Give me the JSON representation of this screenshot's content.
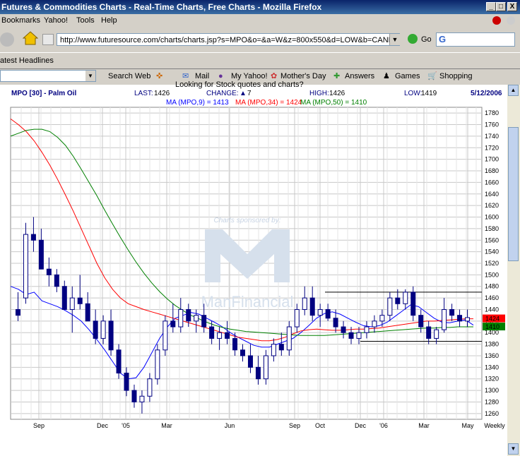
{
  "window": {
    "title": "Futures & Commodities Charts - Real-Time Charts, Free Charts - Mozilla Firefox",
    "min_label": "_",
    "max_label": "□",
    "close_label": "X"
  },
  "menu": {
    "items": [
      "Bookmarks",
      "Yahoo!",
      "Tools",
      "Help"
    ]
  },
  "nav": {
    "url": "http://www.futuresource.com/charts/charts.jsp?s=MPO&o=&a=W&z=800x550&d=LOW&b=CANDLE&st=MA",
    "go_label": "Go"
  },
  "bookmarks": {
    "headlines": "atest Headlines"
  },
  "toolbar": {
    "search_web": "Search Web",
    "mail": "Mail",
    "my_yahoo": "My Yahoo!",
    "mothers_day": "Mother's Day",
    "answers": "Answers",
    "games": "Games",
    "shopping": "Shopping"
  },
  "page": {
    "banner_text": "Looking for Stock quotes and charts?"
  },
  "chart_header": {
    "symbol": "MPO [30] - Palm Oil",
    "last_label": "LAST:",
    "last_value": "1426",
    "change_label": "CHANGE:",
    "change_arrow": "▲",
    "change_value": "7",
    "high_label": "HIGH:",
    "high_value": "1426",
    "low_label": "LOW:",
    "low_value": "1419",
    "date": "5/12/2006"
  },
  "ma_legend": {
    "ma9": "MA (MPO,9) = 1413",
    "ma34": "MA (MPO,34) = 1424",
    "ma50": "MA (MPO,50) = 1410"
  },
  "watermark": {
    "sponsor": "Charts sponsored by:",
    "brand": "ManFinancial"
  },
  "colors": {
    "ma9": "#0000ff",
    "ma34": "#ff0000",
    "ma50": "#008000",
    "candle": "#000080",
    "grid": "#c8c8c8"
  },
  "chart_data": {
    "type": "candlestick",
    "ylim": [
      1250,
      1790
    ],
    "y_ticks": [
      1260,
      1280,
      1300,
      1320,
      1340,
      1360,
      1380,
      1400,
      1420,
      1440,
      1460,
      1480,
      1500,
      1520,
      1540,
      1560,
      1580,
      1600,
      1620,
      1640,
      1660,
      1680,
      1700,
      1720,
      1740,
      1760,
      1780
    ],
    "x_labels": [
      "Sep",
      "Dec",
      "'05",
      "Mar",
      "Jun",
      "Sep",
      "Oct",
      "Dec",
      "'06",
      "Mar",
      "May",
      "Weekly"
    ],
    "price_tags": [
      {
        "value": 1424,
        "label": "1424",
        "color": "#ff0000"
      },
      {
        "value": 1410,
        "label": "1410",
        "color": "#008000"
      }
    ],
    "series": [
      {
        "name": "MA (MPO,9)",
        "values": [
          1480,
          1475,
          1466,
          1470,
          1455,
          1450,
          1445,
          1438,
          1430,
          1420,
          1405,
          1388,
          1370,
          1350,
          1330,
          1320,
          1322,
          1340,
          1365,
          1390,
          1410,
          1425,
          1430,
          1435,
          1432,
          1425,
          1418,
          1410,
          1400,
          1392,
          1385,
          1378,
          1375,
          1375,
          1380,
          1385,
          1390,
          1400,
          1412,
          1425,
          1433,
          1436,
          1432,
          1425,
          1418,
          1412,
          1410,
          1412,
          1418,
          1428,
          1438,
          1448,
          1445,
          1435,
          1425,
          1418,
          1417,
          1420,
          1422,
          1413
        ]
      },
      {
        "name": "MA (MPO,34)",
        "values": [
          1770,
          1760,
          1748,
          1732,
          1712,
          1690,
          1665,
          1638,
          1610,
          1580,
          1550,
          1520,
          1495,
          1475,
          1460,
          1450,
          1445,
          1440,
          1436,
          1432,
          1428,
          1424,
          1420,
          1416,
          1412,
          1408,
          1404,
          1400,
          1396,
          1392,
          1390,
          1388,
          1386,
          1386,
          1388,
          1392,
          1398,
          1403,
          1405,
          1406,
          1405,
          1404,
          1404,
          1405,
          1406,
          1406,
          1407,
          1408,
          1410,
          1412,
          1414,
          1416,
          1418,
          1420,
          1420,
          1421,
          1422,
          1423,
          1424,
          1424
        ]
      },
      {
        "name": "MA (MPO,50)",
        "values": [
          1740,
          1745,
          1750,
          1752,
          1752,
          1748,
          1738,
          1724,
          1705,
          1683,
          1660,
          1637,
          1612,
          1588,
          1565,
          1543,
          1522,
          1503,
          1486,
          1471,
          1458,
          1447,
          1438,
          1430,
          1424,
          1418,
          1413,
          1409,
          1406,
          1404,
          1402,
          1401,
          1400,
          1399,
          1398,
          1397,
          1396,
          1395,
          1395,
          1395,
          1395,
          1396,
          1397,
          1398,
          1399,
          1400,
          1401,
          1402,
          1403,
          1404,
          1405,
          1406,
          1407,
          1408,
          1408,
          1409,
          1409,
          1410,
          1410,
          1410
        ]
      }
    ],
    "candles": [
      [
        1440,
        1470,
        1420,
        1430
      ],
      [
        1460,
        1590,
        1450,
        1570
      ],
      [
        1570,
        1600,
        1540,
        1560
      ],
      [
        1560,
        1580,
        1510,
        1510
      ],
      [
        1510,
        1530,
        1480,
        1500
      ],
      [
        1500,
        1510,
        1470,
        1480
      ],
      [
        1480,
        1490,
        1440,
        1440
      ],
      [
        1440,
        1480,
        1400,
        1460
      ],
      [
        1460,
        1500,
        1440,
        1450
      ],
      [
        1450,
        1470,
        1420,
        1420
      ],
      [
        1420,
        1440,
        1380,
        1390
      ],
      [
        1390,
        1430,
        1380,
        1420
      ],
      [
        1420,
        1440,
        1360,
        1370
      ],
      [
        1370,
        1380,
        1320,
        1330
      ],
      [
        1330,
        1340,
        1290,
        1300
      ],
      [
        1300,
        1310,
        1270,
        1280
      ],
      [
        1280,
        1300,
        1260,
        1290
      ],
      [
        1290,
        1330,
        1280,
        1320
      ],
      [
        1320,
        1380,
        1310,
        1370
      ],
      [
        1370,
        1430,
        1360,
        1420
      ],
      [
        1420,
        1450,
        1400,
        1410
      ],
      [
        1410,
        1460,
        1400,
        1440
      ],
      [
        1440,
        1450,
        1410,
        1420
      ],
      [
        1420,
        1440,
        1400,
        1430
      ],
      [
        1430,
        1450,
        1400,
        1410
      ],
      [
        1410,
        1420,
        1380,
        1390
      ],
      [
        1390,
        1410,
        1370,
        1400
      ],
      [
        1400,
        1420,
        1380,
        1390
      ],
      [
        1390,
        1400,
        1360,
        1370
      ],
      [
        1370,
        1380,
        1350,
        1360
      ],
      [
        1360,
        1380,
        1330,
        1340
      ],
      [
        1340,
        1360,
        1310,
        1320
      ],
      [
        1320,
        1370,
        1310,
        1360
      ],
      [
        1360,
        1390,
        1350,
        1380
      ],
      [
        1380,
        1400,
        1360,
        1370
      ],
      [
        1370,
        1420,
        1360,
        1410
      ],
      [
        1410,
        1450,
        1400,
        1440
      ],
      [
        1440,
        1480,
        1430,
        1460
      ],
      [
        1460,
        1480,
        1420,
        1430
      ],
      [
        1430,
        1450,
        1410,
        1440
      ],
      [
        1440,
        1450,
        1420,
        1425
      ],
      [
        1425,
        1440,
        1400,
        1410
      ],
      [
        1410,
        1420,
        1390,
        1400
      ],
      [
        1400,
        1410,
        1380,
        1390
      ],
      [
        1390,
        1410,
        1380,
        1400
      ],
      [
        1400,
        1420,
        1390,
        1410
      ],
      [
        1410,
        1430,
        1400,
        1420
      ],
      [
        1420,
        1440,
        1410,
        1430
      ],
      [
        1430,
        1470,
        1420,
        1460
      ],
      [
        1460,
        1475,
        1440,
        1450
      ],
      [
        1450,
        1475,
        1440,
        1470
      ],
      [
        1470,
        1480,
        1420,
        1430
      ],
      [
        1430,
        1440,
        1400,
        1410
      ],
      [
        1410,
        1420,
        1380,
        1390
      ],
      [
        1390,
        1410,
        1380,
        1405
      ],
      [
        1405,
        1460,
        1400,
        1440
      ],
      [
        1440,
        1450,
        1420,
        1430
      ],
      [
        1430,
        1440,
        1410,
        1420
      ],
      [
        1420,
        1440,
        1410,
        1426
      ]
    ],
    "hlines": [
      1470,
      1385
    ]
  }
}
